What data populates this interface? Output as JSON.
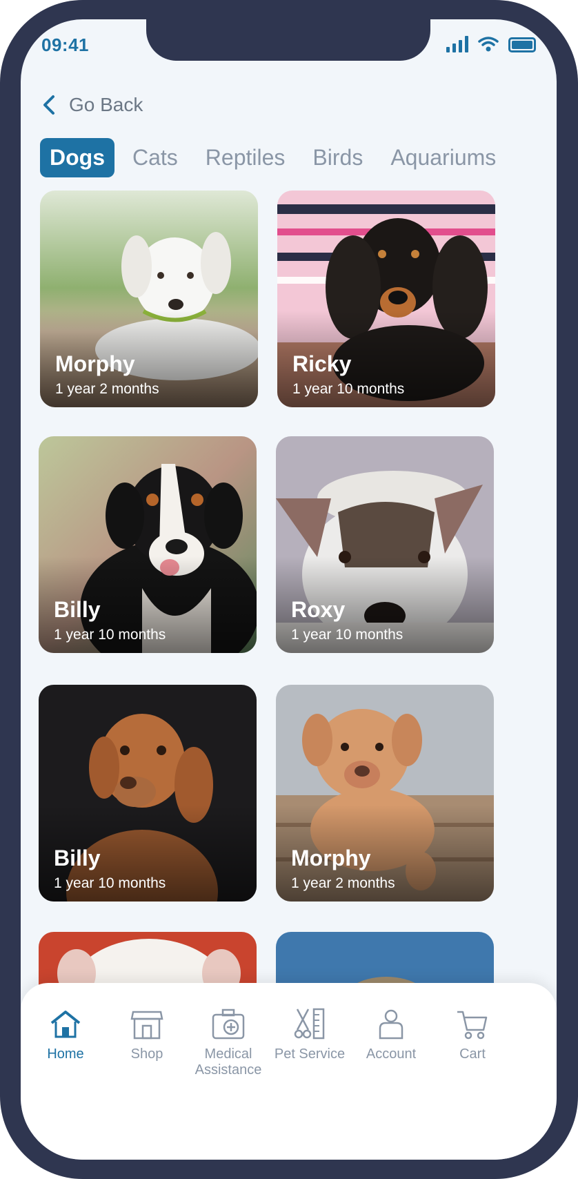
{
  "status_bar": {
    "time": "09:41"
  },
  "header": {
    "back_label": "Go Back"
  },
  "tabs": [
    {
      "label": "Dogs",
      "active": true
    },
    {
      "label": "Cats"
    },
    {
      "label": "Reptiles"
    },
    {
      "label": "Birds"
    },
    {
      "label": "Aquariums"
    }
  ],
  "pets": [
    {
      "name": "Morphy",
      "age": "1 year 2 months"
    },
    {
      "name": "Ricky",
      "age": "1 year 10 months"
    },
    {
      "name": "Billy",
      "age": "1 year 10 months"
    },
    {
      "name": "Roxy",
      "age": "1 year 10 months"
    },
    {
      "name": "Billy",
      "age": "1 year 10 months"
    },
    {
      "name": "Morphy",
      "age": "1 year 2 months"
    }
  ],
  "bottom_nav": [
    {
      "label": "Home",
      "icon": "home-icon",
      "active": true
    },
    {
      "label": "Shop",
      "icon": "shop-icon"
    },
    {
      "label": "Medical Assistance",
      "icon": "medical-kit-icon"
    },
    {
      "label": "Pet Service",
      "icon": "grooming-icon"
    },
    {
      "label": "Account",
      "icon": "account-icon"
    },
    {
      "label": "Cart",
      "icon": "cart-icon"
    }
  ],
  "colors": {
    "accent": "#1e72a4",
    "frame": "#2f3650",
    "background": "#f2f6fa"
  }
}
